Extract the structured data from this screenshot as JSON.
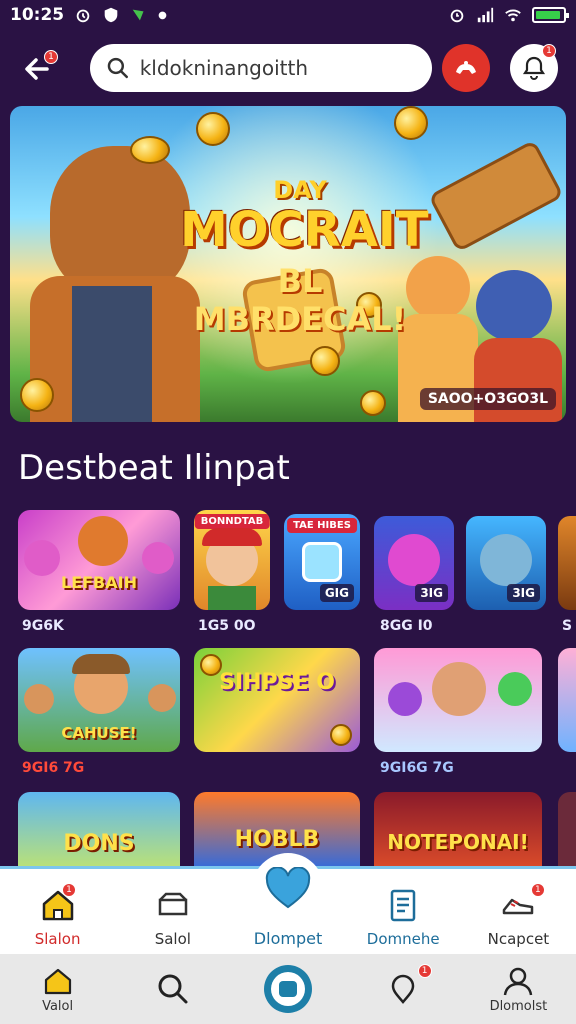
{
  "status_bar": {
    "time": "10:25"
  },
  "header": {
    "search_value": "kldokninangoitth",
    "back_badge": "1",
    "bell_badge": "1"
  },
  "banner": {
    "title_small": "DAY",
    "title_big": "MOCRAIT",
    "title_mid": "BL MBRDECAL!",
    "tag": "SAOO+O3GO3L"
  },
  "section": {
    "title": "Destbeat Ilinpat"
  },
  "games": {
    "row1": [
      {
        "title": "LEFBAIH",
        "label": "9G6K"
      },
      {
        "ribbon": "BONNDTAB",
        "label": "1G5 0O"
      },
      {
        "ribbon": "TAE HIBES",
        "chip": "GIG",
        "label": ""
      },
      {
        "chip": "3IG",
        "label": "8GG I0"
      },
      {
        "chip": "3IG",
        "label": ""
      }
    ],
    "row2": [
      {
        "title": "CAHUSE!",
        "label": "9GI6 7G"
      },
      {
        "title": "SIHPSE O",
        "label": ""
      },
      {
        "title": "",
        "label": "9GI6G 7G"
      }
    ],
    "row3": [
      {
        "title": "DONS",
        "label": ""
      },
      {
        "title": "HOBLB",
        "label": ""
      },
      {
        "title": "NOTEPONAI!",
        "label": ""
      }
    ]
  },
  "bottom_nav": {
    "items": [
      {
        "label": "Slalon",
        "badge": "1"
      },
      {
        "label": "Salol"
      },
      {
        "label": "Dlompet"
      },
      {
        "label": "Domnehe"
      },
      {
        "label": "Ncapcet",
        "badge": "1"
      }
    ]
  },
  "system_nav": {
    "items": [
      {
        "label": "Valol"
      },
      {
        "label": ""
      },
      {
        "label": ""
      },
      {
        "label": "",
        "badge": "1"
      },
      {
        "label": "Dlomolst"
      }
    ]
  },
  "colors": {
    "background": "#2a1244",
    "accent_red": "#e0332a",
    "accent_blue": "#1d8bc7"
  }
}
